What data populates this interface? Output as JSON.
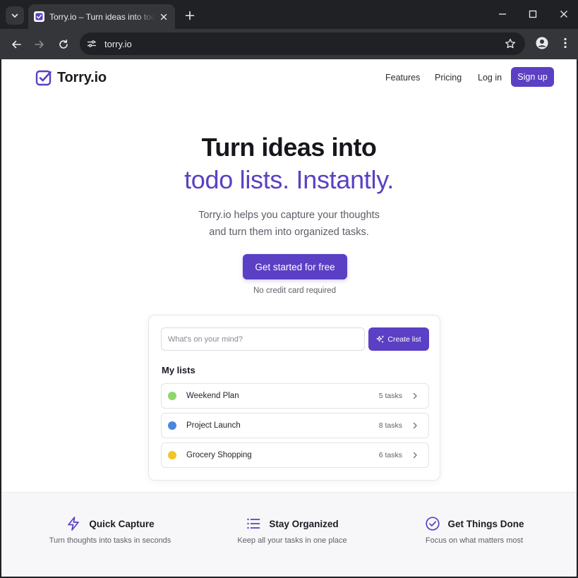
{
  "browser": {
    "tab_title": "Torry.io – Turn ideas into todo lists",
    "url": "torry.io"
  },
  "header": {
    "logo_text": "Torry.io",
    "nav": {
      "features": "Features",
      "pricing": "Pricing",
      "login": "Log in",
      "signup": "Sign up"
    }
  },
  "hero": {
    "title": "Turn ideas into",
    "accent": "todo lists. Instantly.",
    "subtitle_line1": "Torry.io helps you capture your thoughts",
    "subtitle_line2": "and turn them into organized tasks.",
    "cta": "Get started for free",
    "cta_note": "No credit card required"
  },
  "card": {
    "input_placeholder": "What's on your mind?",
    "create_button": "Create list",
    "lists_heading": "My lists",
    "lists": [
      {
        "name": "Weekend Plan",
        "count": "5 tasks",
        "color": "#8fd66b"
      },
      {
        "name": "Project Launch",
        "count": "8 tasks",
        "color": "#4a86e0"
      },
      {
        "name": "Grocery Shopping",
        "count": "6 tasks",
        "color": "#f2c527"
      }
    ]
  },
  "features": [
    {
      "title": "Quick Capture",
      "desc": "Turn thoughts into tasks in seconds",
      "icon": "lightning-icon"
    },
    {
      "title": "Stay Organized",
      "desc": "Keep all your tasks in one place",
      "icon": "list-icon"
    },
    {
      "title": "Get Things Done",
      "desc": "Focus on what matters most",
      "icon": "check-circle-icon"
    }
  ],
  "colors": {
    "brand": "#5b3fc4",
    "accent_text": "#5a41c2",
    "chrome_dark": "#202124",
    "chrome_toolbar": "#35363a"
  }
}
